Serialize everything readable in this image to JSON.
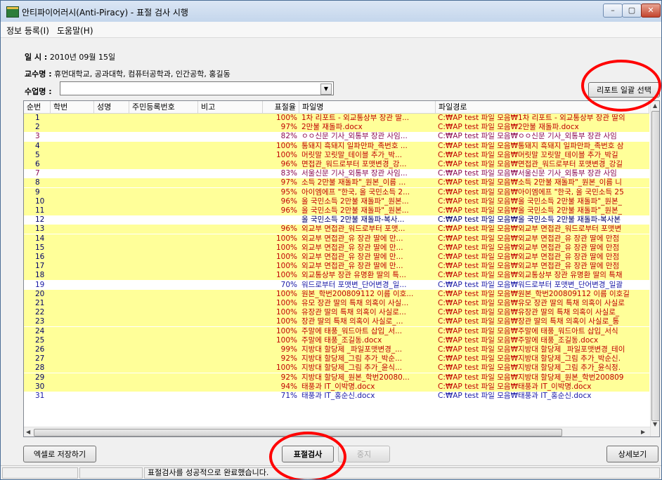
{
  "window": {
    "title": "안티파이어러시(Anti-Piracy) - 표절 검사 시행",
    "controls": {
      "min": "–",
      "max": "▢",
      "close": "✕"
    }
  },
  "menu": [
    "정보 등록(I)",
    "도움말(H)"
  ],
  "info": {
    "date_label": "일    시 :",
    "date_value": "2010년 09월 15일",
    "prof_label": "교수명 :",
    "prof_value": "휴먼대학교, 공과대학, 컴퓨터공학과, 인간공학, 홍길동",
    "subject_label": "수업명 :",
    "subject_value": ""
  },
  "buttons": {
    "report_select": "리포트 일괄 선택",
    "excel_save": "엑셀로 저장하기",
    "plagiarism_check": "표절검사",
    "stop": "중지",
    "detail": "상세보기"
  },
  "table": {
    "headers": [
      "순번",
      "학번",
      "성명",
      "주민등록번호",
      "비고",
      "표절율",
      "파일명",
      "파일경로"
    ],
    "rows": [
      {
        "num": "1",
        "rate": "100%",
        "file": "1차 리포트 - 외교통상부 장관 딸...",
        "path": "C:₩AP test 파일 모음₩1차 리포트 - 외교통상부 장관 딸의",
        "style": "y"
      },
      {
        "num": "2",
        "rate": "97%",
        "file": "2만불 재돌파.docx",
        "path": "C:₩AP test 파일 모음₩2만불 재돌파.docx",
        "style": "y"
      },
      {
        "num": "3",
        "rate": "82%",
        "file": "ㅇㅇ신문 기사_외통부 장관 사임...",
        "path": "C:₩AP test 파일 모음₩ㅇㅇ신문 기사_외통부 장관 사임",
        "style": "w"
      },
      {
        "num": "4",
        "rate": "100%",
        "file": "통돼지 흑돼지 일파만파_족번호 ...",
        "path": "C:₩AP test 파일 모음₩통돼지 흑돼지 일파만파_족번호 삼",
        "style": "y"
      },
      {
        "num": "5",
        "rate": "100%",
        "file": "머릿말 꼬릿말_테이블 추가_박...",
        "path": "C:₩AP test 파일 모음₩머릿말 꼬릿말_테이블 추가_박길",
        "style": "y"
      },
      {
        "num": "6",
        "rate": "96%",
        "file": "면접관_워드로부터 포맷변경_강...",
        "path": "C:₩AP test 파일 모음₩면접관_워드로부터 포맷변경_강길",
        "style": "y"
      },
      {
        "num": "7",
        "rate": "83%",
        "file": "서울신문 기사_외통부 장관 사임...",
        "path": "C:₩AP test 파일 모음₩서울신문 기사_외통부 장관 사임",
        "style": "w"
      },
      {
        "num": "8",
        "rate": "97%",
        "file": "소득 2만불 재돌파\"_원본_이름 ...",
        "path": "C:₩AP test 파일 모음₩소득 2만불 재돌파\"_원본_이름 니",
        "style": "y"
      },
      {
        "num": "9",
        "rate": "95%",
        "file": "아이엠에프 \"한국, 올 국민소득 2...",
        "path": "C:₩AP test 파일 모음₩아이엠에프 \"한국, 올 국민소득 25",
        "style": "y"
      },
      {
        "num": "10",
        "rate": "96%",
        "file": "올 국민소득 2만불 재돌파\"_원본...",
        "path": "C:₩AP test 파일 모음₩올 국민소득 2만불 재돌파\"_원본_",
        "style": "y"
      },
      {
        "num": "11",
        "rate": "96%",
        "file": "올 국민소득 2만불 재돌파\"_원본...",
        "path": "C:₩AP test 파일 모음₩올 국민소득 2만불 재돌파\"_원본_",
        "style": "y"
      },
      {
        "num": "12",
        "rate": "",
        "file": "올 국민소득 2만불 재돌파-복사...",
        "path": "C:₩AP test 파일 모음₩올 국민소득 2만불 재돌파-복사본",
        "style": "plain"
      },
      {
        "num": "13",
        "rate": "96%",
        "file": "외교부 면접관_워드로부터 포맷...",
        "path": "C:₩AP test 파일 모음₩외교부 면접관_워드로부터 포맷변",
        "style": "y"
      },
      {
        "num": "14",
        "rate": "100%",
        "file": "외교부 면접관_유 장관 딸에 만...",
        "path": "C:₩AP test 파일 모음₩외교부 면접관_유 장관 딸에 만점",
        "style": "y"
      },
      {
        "num": "15",
        "rate": "100%",
        "file": "외교부 면접관_유 장관 딸에 만...",
        "path": "C:₩AP test 파일 모음₩외교부 면접관_유 장관 딸에 만점",
        "style": "y"
      },
      {
        "num": "16",
        "rate": "100%",
        "file": "외교부 면접관_유 장관 딸에 만...",
        "path": "C:₩AP test 파일 모음₩외교부 면접관_유 장관 딸에 만점",
        "style": "y"
      },
      {
        "num": "17",
        "rate": "100%",
        "file": "외교부 면접관_유 장관 딸에 만...",
        "path": "C:₩AP test 파일 모음₩외교부 면접관_유 장관 딸에 만점",
        "style": "y"
      },
      {
        "num": "18",
        "rate": "100%",
        "file": "외교통상부 장관 유명환 딸의 특...",
        "path": "C:₩AP test 파일 모음₩외교통상부 장관 유명환 딸의 특채",
        "style": "y"
      },
      {
        "num": "19",
        "rate": "70%",
        "file": "워드로부터 포맷변_단어변경_일...",
        "path": "C:₩AP test 파일 모음₩워드로부터 포맷변_단어변경_일괄",
        "style": "blue"
      },
      {
        "num": "20",
        "rate": "100%",
        "file": "원본_학번200809112 이름 이호...",
        "path": "C:₩AP test 파일 모음₩원본_학번200809112 이름 이호길",
        "style": "y"
      },
      {
        "num": "21",
        "rate": "100%",
        "file": "유모 장관 딸의 특채 의혹이 사실...",
        "path": "C:₩AP test 파일 모음₩유모 장관 딸의 특채 의혹이 사실로",
        "style": "y"
      },
      {
        "num": "22",
        "rate": "100%",
        "file": "유장관 딸의 특채 의혹이 사실로...",
        "path": "C:₩AP test 파일 모음₩유장관 딸의 특채 의혹이 사실로_",
        "style": "y"
      },
      {
        "num": "23",
        "rate": "100%",
        "file": "장관 딸의 특채 의혹이 사실로_...",
        "path": "C:₩AP test 파일 모음₩장관 딸의 특채 의혹이 사실로_통",
        "style": "y"
      },
      {
        "num": "24",
        "rate": "100%",
        "file": "주말에 태풍_워드아트 삽입_서...",
        "path": "C:₩AP test 파일 모음₩주말에 태풍_워드아트 삽입_서식",
        "style": "y"
      },
      {
        "num": "25",
        "rate": "100%",
        "file": "주말에 태풍_조길동.docx",
        "path": "C:₩AP test 파일 모음₩주말에 태풍_조길동.docx",
        "style": "y"
      },
      {
        "num": "26",
        "rate": "99%",
        "file": "지방대 할당제 _파일포맷변경_...",
        "path": "C:₩AP test 파일 모음₩지방대 할당제 _파일포맷변경_테이",
        "style": "y"
      },
      {
        "num": "27",
        "rate": "92%",
        "file": "지방대 할당제_그림 추가_박순...",
        "path": "C:₩AP test 파일 모음₩지방대 할당제_그림 추가_박순신.",
        "style": "y"
      },
      {
        "num": "28",
        "rate": "100%",
        "file": "지방대 할당제_그림 추가_윤식...",
        "path": "C:₩AP test 파일 모음₩지방대 할당제_그림 추가_윤식정.",
        "style": "y"
      },
      {
        "num": "29",
        "rate": "92%",
        "file": "지방대 할당제_원본_학번20080...",
        "path": "C:₩AP test 파일 모음₩지방대 할당제_원본_학번200809",
        "style": "y"
      },
      {
        "num": "30",
        "rate": "94%",
        "file": "태풍과 IT_이박명.docx",
        "path": "C:₩AP test 파일 모음₩태풍과 IT_이박명.docx",
        "style": "y"
      },
      {
        "num": "31",
        "rate": "71%",
        "file": "태풍과 IT_홍순신.docx",
        "path": "C:₩AP test 파일 모음₩태풍과 IT_홍순신.docx",
        "style": "blue"
      }
    ]
  },
  "status": {
    "message": "표절검사를 성공적으로 완료했습니다."
  },
  "colors": {
    "yellow_row": "#ffff99",
    "red_text": "#c00000",
    "blue_text": "#1a1aa6",
    "dark_text": "#000066",
    "highlight_circle": "#ff0000"
  }
}
